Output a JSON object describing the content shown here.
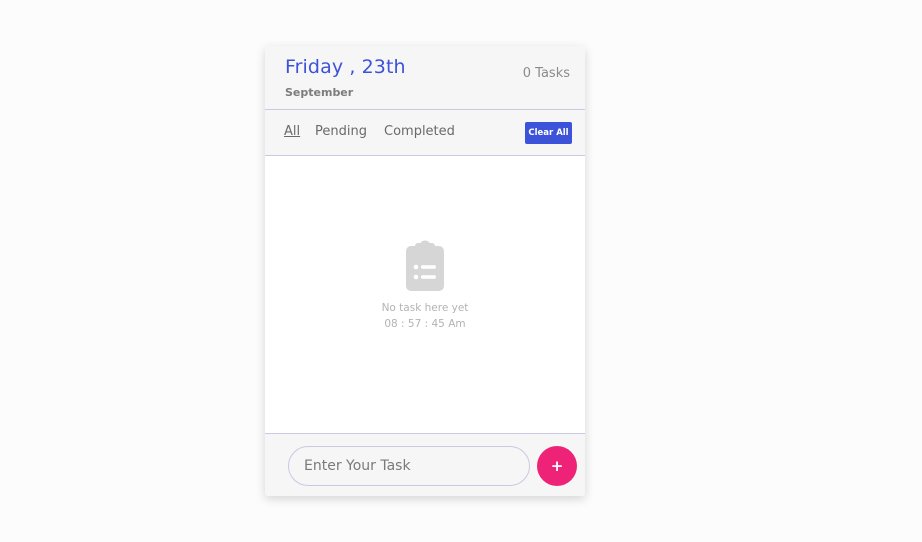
{
  "header": {
    "day_title": "Friday , 23th",
    "month": "September",
    "task_count": "0 Tasks"
  },
  "filters": {
    "all": "All",
    "pending": "Pending",
    "completed": "Completed",
    "active": "All",
    "clear_all": "Clear All"
  },
  "empty_state": {
    "icon": "clipboard-list-icon",
    "message": "No task here yet",
    "time": "08 : 57 : 45 Am"
  },
  "input": {
    "placeholder": "Enter Your Task",
    "value": ""
  },
  "add_button": {
    "label": "+"
  },
  "colors": {
    "accent": "#3c52d9",
    "add_button": "#ee2277",
    "border": "#c9c9e2",
    "panel_bg": "#f6f6f6"
  }
}
